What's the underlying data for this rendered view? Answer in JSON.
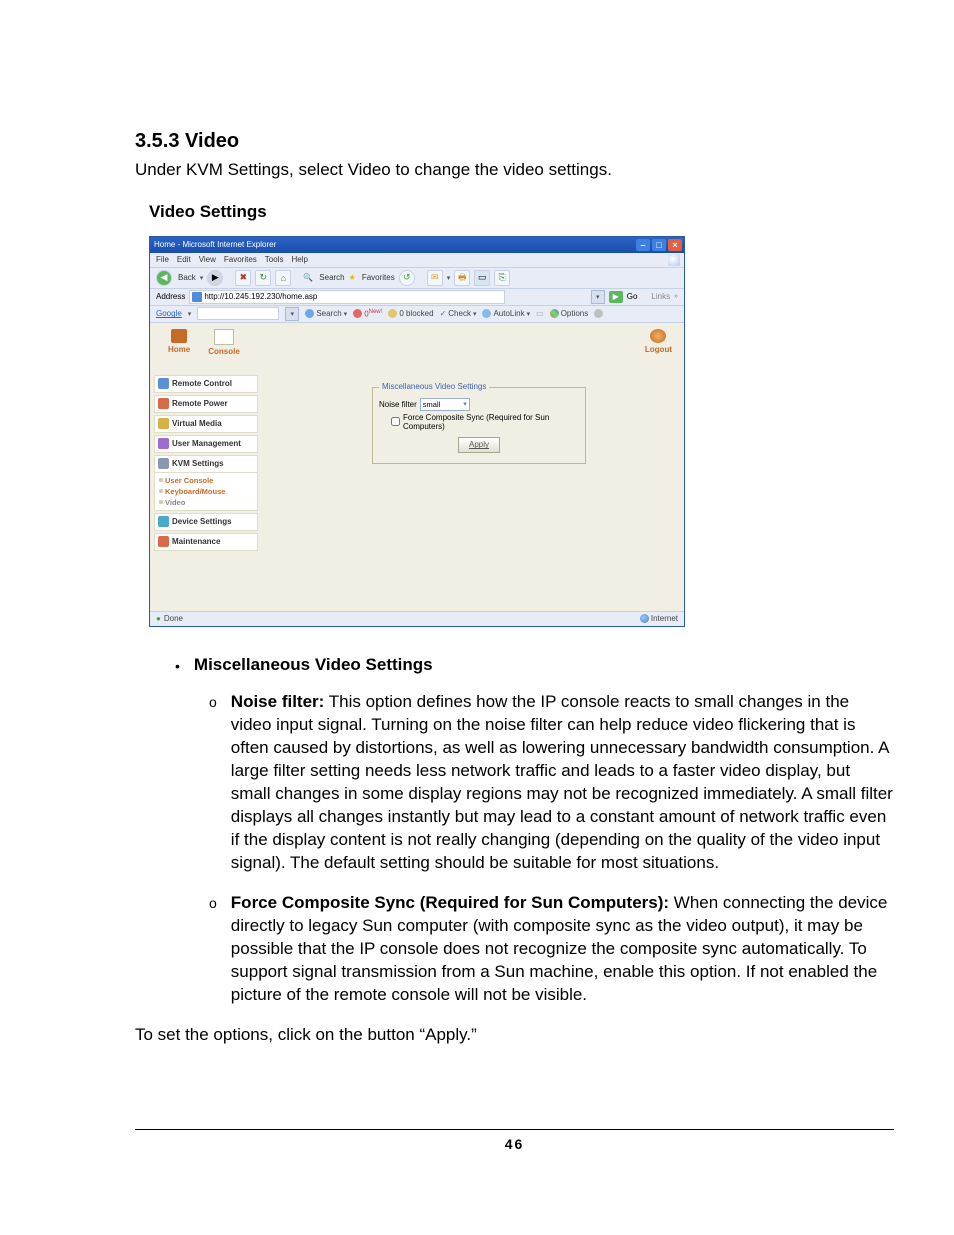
{
  "doc": {
    "heading": "3.5.3 Video",
    "heading_desc": "Under KVM Settings, select Video to change the video settings.",
    "subheading": "Video Settings",
    "page_number": "46",
    "bullet_l1_label": "Miscellaneous Video Settings",
    "noise_filter_label": "Noise filter:",
    "noise_filter_text": " This option defines how the IP console reacts to small changes in the video input signal. Turning on the noise filter can help reduce video flickering that is often caused by distortions, as well as lowering unnecessary bandwidth consumption. A large filter setting needs less network traffic and leads to a faster video display, but small changes in some display regions may not be recognized immediately. A small filter displays all changes instantly but may lead to a constant amount of network traffic even if the display content is not really changing (depending on the quality of the video input signal). The default setting should be suitable for most situations.",
    "force_sync_label": "Force Composite Sync (Required for Sun Computers):",
    "force_sync_text": " When connecting the device directly to legacy Sun computer (with composite sync as the video output), it may be possible that the IP console does not recognize the composite sync automatically. To support signal transmission from a Sun machine, enable this option. If not enabled the picture of the remote console will not be visible.",
    "closing": "To set the options, click on the button “Apply.”"
  },
  "ie": {
    "title": "Home - Microsoft Internet Explorer",
    "menu": {
      "file": "File",
      "edit": "Edit",
      "view": "View",
      "favorites": "Favorites",
      "tools": "Tools",
      "help": "Help"
    },
    "toolbar": {
      "back": "Back",
      "search": "Search",
      "favorites": "Favorites"
    },
    "address_label": "Address",
    "address_value": "http://10.245.192.230/home.asp",
    "go": "Go",
    "links": "Links",
    "google": {
      "logo": "Google",
      "search": "Search",
      "blocked": "0 blocked",
      "check": "Check",
      "autolink": "AutoLink",
      "options": "Options"
    },
    "status_done": "Done",
    "status_zone": "Internet"
  },
  "app": {
    "top": {
      "home": "Home",
      "console": "Console",
      "logout": "Logout"
    },
    "nav": {
      "remote_control": "Remote Control",
      "remote_power": "Remote Power",
      "virtual_media": "Virtual Media",
      "user_mgmt": "User Management",
      "kvm_settings": "KVM Settings",
      "sub_user_console": "User Console",
      "sub_keyboard_mouse": "Keyboard/Mouse",
      "sub_video": "Video",
      "device_settings": "Device Settings",
      "maintenance": "Maintenance"
    },
    "form": {
      "legend": "Miscellaneous Video Settings",
      "noise_filter_label": "Noise filter",
      "noise_filter_value": "small",
      "force_sync": "Force Composite Sync (Required for Sun Computers)",
      "apply": "Apply"
    }
  }
}
